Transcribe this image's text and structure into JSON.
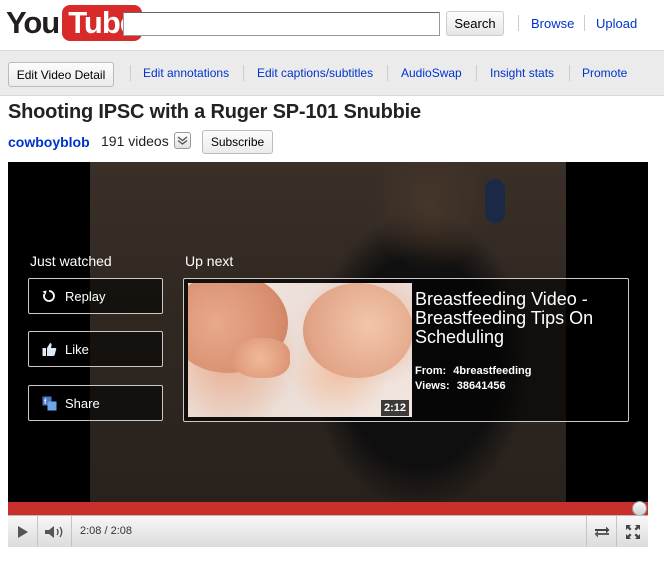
{
  "header": {
    "logo": {
      "you": "You",
      "tube": "Tube"
    },
    "search": {
      "value": "",
      "placeholder": "",
      "button_label": "Search"
    },
    "links": [
      "Browse",
      "Upload"
    ]
  },
  "editbar": {
    "detail_button": "Edit Video Detail",
    "links": [
      "Edit annotations",
      "Edit captions/subtitles",
      "AudioSwap",
      "Insight stats",
      "Promote"
    ]
  },
  "video": {
    "title": "Shooting IPSC with a Ruger SP-101 Snubbie",
    "channel": "cowboyblob",
    "video_count": "191 videos",
    "subscribe_label": "Subscribe"
  },
  "endscreen": {
    "just_watched_title": "Just watched",
    "up_next_title": "Up next",
    "actions": [
      {
        "label": "Replay",
        "icon": "replay-icon"
      },
      {
        "label": "Like",
        "icon": "thumbs-up-icon"
      },
      {
        "label": "Share",
        "icon": "share-icon"
      }
    ],
    "up_next": {
      "title": "Breastfeeding Video - Breastfeeding Tips On Scheduling",
      "from_label": "From:",
      "from_value": "4breastfeeding",
      "views_label": "Views:",
      "views_value": "38641456",
      "duration": "2:12"
    }
  },
  "player": {
    "time": "2:08 / 2:08",
    "progress_fraction": 1.0,
    "colors": {
      "progress": "#c9302c",
      "link": "#0033cc",
      "logo_red": "#d92a2a"
    }
  }
}
